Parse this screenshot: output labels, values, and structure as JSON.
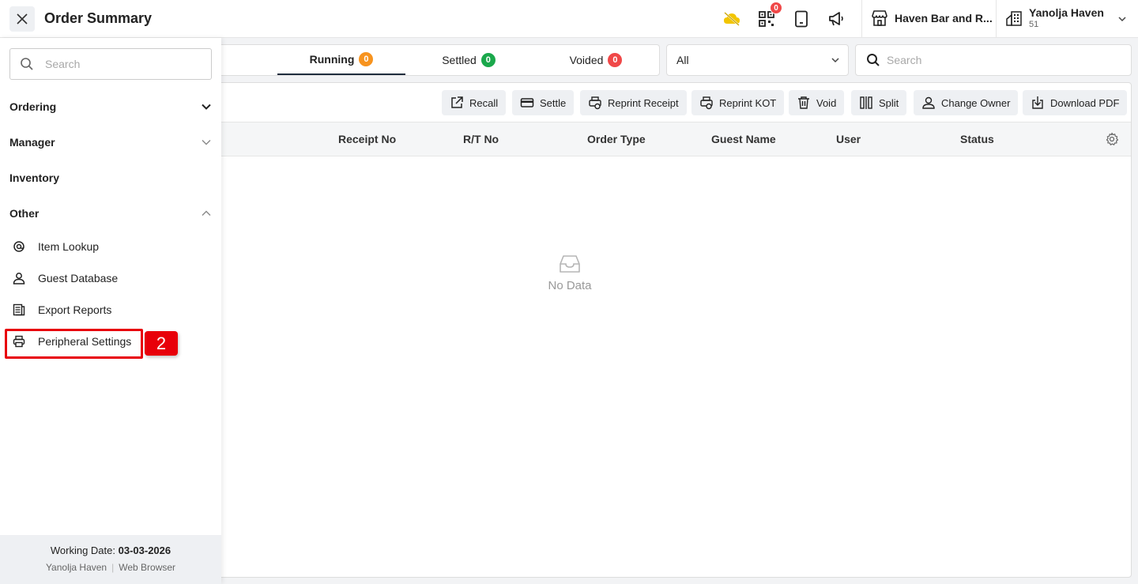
{
  "header": {
    "title": "Order Summary",
    "qr_badge": "0",
    "outlet_name": "Haven Bar and R...",
    "property_name": "Yanolja Haven",
    "property_id": "51"
  },
  "tabs": [
    {
      "label": "Running",
      "count": "0",
      "color": "#f7931e",
      "active": true
    },
    {
      "label": "Settled",
      "count": "0",
      "color": "#1aa84b",
      "active": false
    },
    {
      "label": "Voided",
      "count": "0",
      "color": "#f04848",
      "active": false
    }
  ],
  "filter": {
    "value": "All"
  },
  "search": {
    "placeholder": "Search"
  },
  "actions": [
    {
      "label": "Recall",
      "icon": "external-link-icon"
    },
    {
      "label": "Settle",
      "icon": "card-icon"
    },
    {
      "label": "Reprint Receipt",
      "icon": "printer-refresh-icon"
    },
    {
      "label": "Reprint KOT",
      "icon": "printer-refresh-icon"
    },
    {
      "label": "Void",
      "icon": "trash-icon"
    },
    {
      "label": "Split",
      "icon": "split-icon"
    },
    {
      "label": "Change Owner",
      "icon": "user-icon"
    },
    {
      "label": "Download PDF",
      "icon": "download-icon"
    }
  ],
  "table": {
    "columns": [
      "Receipt No",
      "R/T No",
      "Order Type",
      "Guest Name",
      "User",
      "Status"
    ],
    "empty_text": "No Data"
  },
  "sidebar": {
    "search_placeholder": "Search",
    "sections": [
      {
        "label": "Ordering",
        "expanded": false
      },
      {
        "label": "Manager",
        "expanded": false
      },
      {
        "label": "Inventory"
      },
      {
        "label": "Other",
        "expanded": true
      }
    ],
    "other_items": [
      {
        "label": "Item Lookup",
        "icon": "at-icon"
      },
      {
        "label": "Guest Database",
        "icon": "person-icon"
      },
      {
        "label": "Export Reports",
        "icon": "report-icon"
      },
      {
        "label": "Peripheral Settings",
        "icon": "printer-icon"
      }
    ],
    "step_badge": "2",
    "footer": {
      "working_date_label": "Working Date:",
      "working_date": "03-03-2026",
      "property": "Yanolja Haven",
      "client": "Web Browser"
    }
  }
}
